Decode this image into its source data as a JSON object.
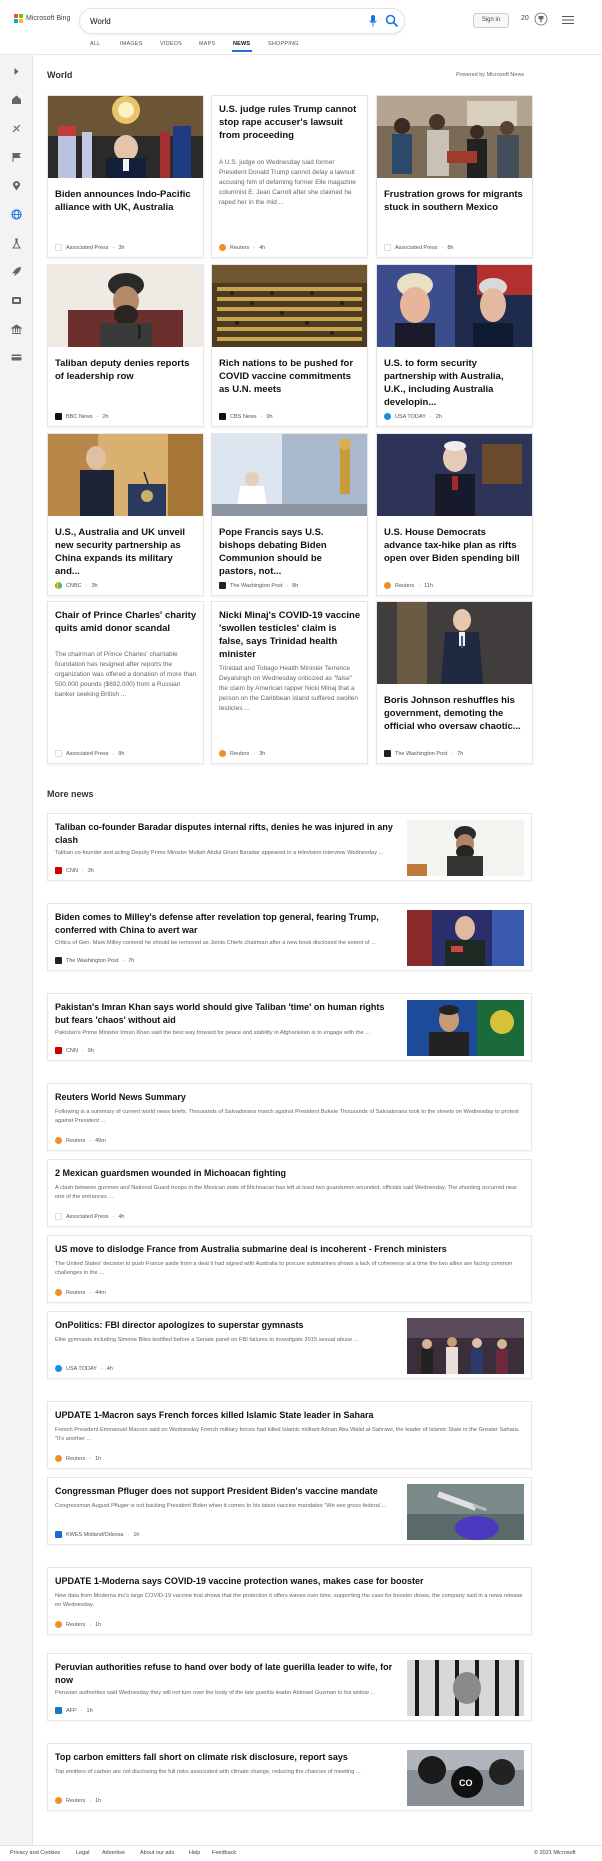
{
  "header": {
    "brand": "Microsoft Bing",
    "search_value": "World",
    "signin_label": "Sign in",
    "points": "20",
    "brand_colors": [
      "#f35325",
      "#81bc06",
      "#05a6f0",
      "#ffba08"
    ]
  },
  "tabs": [
    {
      "label": "ALL"
    },
    {
      "label": "IMAGES"
    },
    {
      "label": "VIDEOS"
    },
    {
      "label": "MAPS"
    },
    {
      "label": "NEWS",
      "active": true
    },
    {
      "label": "SHOPPING"
    }
  ],
  "sidebar_icons": [
    "chevron-right-icon",
    "home-icon",
    "sports-icon",
    "flag-icon",
    "location-icon",
    "globe-icon",
    "science-icon",
    "rocket-icon",
    "entertainment-icon",
    "politics-icon",
    "money-icon"
  ],
  "section": {
    "title": "World",
    "powered_by": "Powered by Microsoft News"
  },
  "cards": [
    {
      "headline": "Biden announces Indo-Pacific alliance with UK, Australia",
      "snippet": "",
      "source": "Associated Press",
      "time": "3h",
      "icon": "ap-logo-icon",
      "image": "chandelier-flags-icon"
    },
    {
      "headline": "U.S. judge rules Trump cannot stop rape accuser's lawsuit from proceeding",
      "snippet": "A U.S. judge on Wednesday said former President Donald Trump cannot delay a lawsuit accusing him of defaming former Elle magazine columnist E. Jean Carroll after she claimed he raped her in the mid ...",
      "source": "Reuters",
      "time": "4h",
      "icon": "reuters-logo-icon",
      "image": ""
    },
    {
      "headline": "Frustration grows for migrants stuck in southern Mexico",
      "snippet": "",
      "source": "Associated Press",
      "time": "8h",
      "icon": "ap-logo-icon",
      "image": "crowd-photo-icon"
    },
    {
      "headline": "Taliban deputy denies reports of leadership row",
      "snippet": "",
      "source": "BBC News",
      "time": "2h",
      "icon": "bbc-logo-icon",
      "image": "portrait-photo-icon"
    },
    {
      "headline": "Rich nations to be pushed for COVID vaccine commitments as U.N. meets",
      "snippet": "",
      "source": "CBS News",
      "time": "9h",
      "icon": "cbs-logo-icon",
      "image": "assembly-hall-icon"
    },
    {
      "headline": "U.S. to form security partnership with Australia, U.K., including Australia developin...",
      "snippet": "",
      "source": "USA TODAY",
      "time": "2h",
      "icon": "usatoday-logo-icon",
      "image": "split-portraits-icon"
    },
    {
      "headline": "U.S., Australia and UK unveil new security partnership as China expands its military and...",
      "snippet": "",
      "source": "CNBC",
      "time": "3h",
      "icon": "cnbc-logo-icon",
      "image": "podium-photo-icon"
    },
    {
      "headline": "Pope Francis says U.S. bishops debating Biden Communion should be pastors, not...",
      "snippet": "",
      "source": "The Washington Post",
      "time": "8h",
      "icon": "wapo-logo-icon",
      "image": "pope-photo-icon"
    },
    {
      "headline": "U.S. House Democrats advance tax-hike plan as rifts open over Biden spending bill",
      "snippet": "",
      "source": "Reuters",
      "time": "11h",
      "icon": "reuters-logo-icon",
      "image": "speaker-photo-icon"
    },
    {
      "headline": "Chair of Prince Charles' charity quits amid donor scandal",
      "snippet": "The chairman of Prince Charles' charitable foundation has resigned after reports the organization was offered a donation of more than 500,000 pounds ($692,000) from a Russian banker seeking British ...",
      "source": "Associated Press",
      "time": "9h",
      "icon": "ap-logo-icon",
      "image": ""
    },
    {
      "headline": "Nicki Minaj's COVID-19 vaccine 'swollen testicles' claim is false, says Trinidad health minister",
      "snippet": "Trinidad and Tobago Health Minister Terrence Deyalsingh on Wednesday criticized as \"false\" the claim by American rapper Nicki Minaj that a person on the Caribbean island suffered swollen testicles ...",
      "source": "Reuters",
      "time": "3h",
      "icon": "reuters-logo-icon",
      "image": ""
    },
    {
      "headline": "Boris Johnson reshuffles his government, demoting the official who oversaw chaotic...",
      "snippet": "",
      "source": "The Washington Post",
      "time": "7h",
      "icon": "wapo-logo-icon",
      "image": "walking-man-photo-icon"
    }
  ],
  "more_news": {
    "title": "More news",
    "items": [
      {
        "headline": "Taliban co-founder Baradar disputes internal rifts, denies he was injured in any clash",
        "snippet": "Taliban co-founder and acting Deputy Prime Minister Mullah Abdul Ghani Baradar appeared in a television interview Wednesday ...",
        "source": "CNN",
        "time": "3h",
        "icon": "cnn-logo-icon",
        "thumb": "interview-photo-icon"
      },
      {
        "headline": "Biden comes to Milley's defense after revelation top general, fearing Trump, conferred with China to avert war",
        "snippet": "Critics of Gen. Mark Milley contend he should be removed as Joints Chiefs chairman after a new book disclosed the extent of ...",
        "source": "The Washington Post",
        "time": "7h",
        "icon": "wapo-logo-icon",
        "thumb": "general-photo-icon"
      },
      {
        "headline": "Pakistan's Imran Khan says world should give Taliban 'time' on human rights but fears 'chaos' without aid",
        "snippet": "Pakistan's Prime Minister Imran Khan said the best way forward for peace and stability in Afghanistan is to engage with the ...",
        "source": "CNN",
        "time": "9h",
        "icon": "cnn-logo-icon",
        "thumb": "flag-speaker-photo-icon"
      },
      {
        "headline": "Reuters World News Summary",
        "snippet": "Following is a summary of current world news briefs. Thousands of Salvadorans march against President Bukele Thousands of Salvadorans took to the streets on Wednesday to protest against President ...",
        "source": "Reuters",
        "time": "49m",
        "icon": "reuters-logo-icon",
        "thumb": ""
      },
      {
        "headline": "2 Mexican guardsmen wounded in Michoacan fighting",
        "snippet": "A clash between gunmen and National Guard troops in the Mexican state of Michoacan has left at least two guardsmen wounded, officials said Wednesday. The shooting occurred near one of the entrances ...",
        "source": "Associated Press",
        "time": "4h",
        "icon": "ap-logo-icon",
        "thumb": ""
      },
      {
        "headline": "US move to dislodge France from Australia submarine deal is incoherent - French ministers",
        "snippet": "The United States' decision to push France aside from a deal it had signed with Australia to procure submarines shows a lack of coherence at a time the two allies are facing common challenges in the ...",
        "source": "Reuters",
        "time": "44m",
        "icon": "reuters-logo-icon",
        "thumb": ""
      },
      {
        "headline": "OnPolitics: FBI director apologizes to superstar gymnasts",
        "snippet": "Elite gymnasts including Simone Biles testified before a Senate panel on FBI failures to investigate 2015 sexual abuse ...",
        "source": "USA TODAY",
        "time": "4h",
        "icon": "usatoday-logo-icon",
        "thumb": "hearing-photo-icon"
      },
      {
        "headline": "UPDATE 1-Macron says French forces killed Islamic State leader in Sahara",
        "snippet": "French President Emmanuel Macron said on Wednesday French military forces had killed Islamic militant Adnan Abu Walid al-Sahrawi, the leader of Islamic State in the Greater Sahara. \"It's another ...",
        "source": "Reuters",
        "time": "1h",
        "icon": "reuters-logo-icon",
        "thumb": ""
      },
      {
        "headline": "Congressman Pfluger does not support President Biden's vaccine mandate",
        "snippet": "Congressman August Pfluger is not backing President Biden when it comes to his latest vaccine mandates \"We see gross federal ...",
        "source": "KWES Midland/Odessa",
        "time": "1h",
        "icon": "kwes-logo-icon",
        "thumb": "vaccine-photo-icon"
      },
      {
        "headline": "UPDATE 1-Moderna says COVID-19 vaccine protection wanes, makes case for booster",
        "snippet": "New data from Moderna Inc's large COVID-19 vaccine trial shows that the protection it offers wanes over time, supporting the case for booster doses, the company said in a news release on Wednesday.",
        "source": "Reuters",
        "time": "1h",
        "icon": "reuters-logo-icon",
        "thumb": ""
      },
      {
        "headline": "Peruvian authorities refuse to hand over body of late guerilla leader to wife, for now",
        "snippet": "Peruvian authorities said Wednesday they will not turn over the body of the late guerilla leader Abimael Guzman to his widow ...",
        "source": "AFP",
        "time": "1h",
        "icon": "afp-logo-icon",
        "thumb": "prison-photo-icon"
      },
      {
        "headline": "Top carbon emitters fall short on climate risk disclosure, report says",
        "snippet": "Top emitters of carbon are not disclosing the full risks associated with climate change, reducing the chances of meeting ...",
        "source": "Reuters",
        "time": "1h",
        "icon": "reuters-logo-icon",
        "thumb": "balloons-photo-icon"
      }
    ]
  },
  "footer": {
    "links": [
      "Privacy and Cookies",
      "Legal",
      "Advertise",
      "About our ads",
      "Help",
      "Feedback"
    ],
    "copyright": "© 2021 Microsoft"
  }
}
